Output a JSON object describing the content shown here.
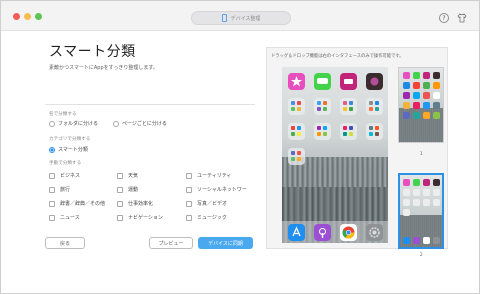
{
  "titlebar": {
    "title": "デバイス整理",
    "help_label": "?"
  },
  "left": {
    "heading": "スマート分類",
    "subtitle": "素敵かつスマートにAppをすっきり整理します。",
    "section_name": "名で分類する",
    "radio_folder": "フォルダに分ける",
    "radio_page": "ページごとに分ける",
    "section_category": "カテゴリで分類する",
    "radio_smart": "スマート分類",
    "section_manual": "手動で分類する",
    "categories": [
      "ビジネス",
      "天気",
      "ユーティリティ",
      "旅行",
      "運動",
      "ソーシャルネットワー",
      "辞書／辞典／その他",
      "仕事効率化",
      "写真／ビデオ",
      "ニュース",
      "ナビゲーション",
      "ミュージック"
    ]
  },
  "buttons": {
    "back": "戻る",
    "preview": "プレビュー",
    "sync": "デバイスに同期"
  },
  "preview": {
    "note": "ドラッグ＆ドロップ機能は右のインタフェースのみで操作可能です。",
    "page1": "1",
    "page2": "2"
  },
  "colors": {
    "accent": "#2b91e6",
    "sync_button": "#4aa8ef"
  }
}
